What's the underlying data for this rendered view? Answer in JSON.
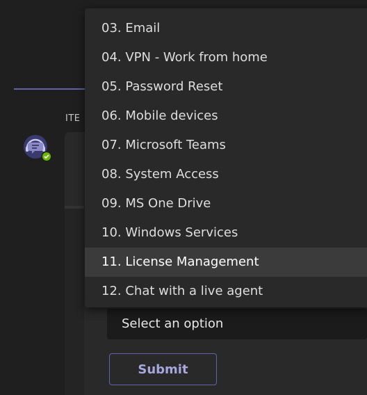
{
  "chat": {
    "sender_label": "ITE"
  },
  "dropdown": {
    "options": [
      "03. Email",
      "04. VPN - Work from home",
      "05. Password Reset",
      "06. Mobile devices",
      "07. Microsoft Teams",
      "08. System Access",
      "09. MS One Drive",
      "10. Windows Services",
      "11. License Management",
      "12. Chat with a live agent"
    ],
    "highlighted_option": "11. License Management"
  },
  "form": {
    "select_placeholder": "Select an option",
    "submit_label": "Submit"
  },
  "icons": {
    "avatar": "bot-avatar-icon",
    "status": "available-check-icon"
  },
  "colors": {
    "accent": "#6264a7",
    "status_available": "#6bb700"
  }
}
